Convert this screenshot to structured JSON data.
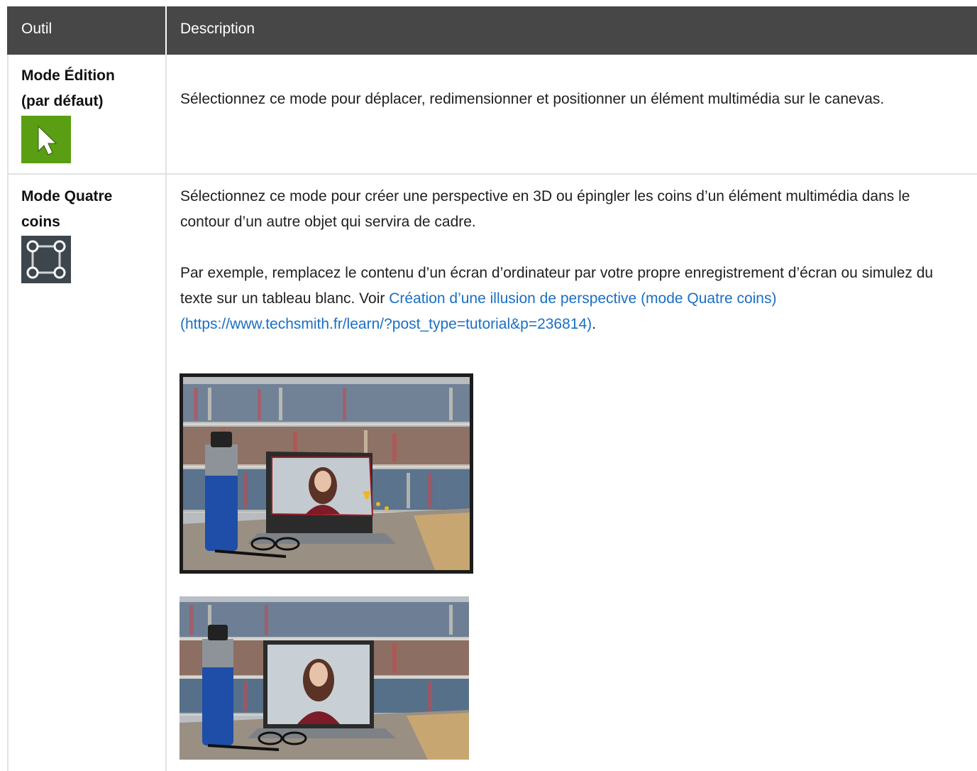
{
  "header": {
    "col_tool": "Outil",
    "col_description": "Description"
  },
  "rows": [
    {
      "tool_line1": "Mode Édition",
      "tool_line2": "(par défaut)",
      "icon": "arrow-cursor-icon",
      "icon_color": "#5a9e13",
      "description": "Sélectionnez ce mode pour déplacer, redimensionner et positionner un élément multimédia sur le canevas."
    },
    {
      "tool_line1": "Mode Quatre",
      "tool_line2": "coins",
      "icon": "four-corners-icon",
      "icon_color": "#3e464d",
      "description_p1": "Sélectionnez ce mode pour créer une perspective en 3D ou épingler les coins d’un élément multimédia dans le contour d’un autre objet qui servira de cadre.",
      "description_p2_text": "Par exemple, remplacez le contenu d’un écran d’ordinateur par votre propre enregistrement d’écran ou simulez du texte sur un tableau blanc. Voir ",
      "description_p2_link": "Création d’une illusion de perspective (mode Quatre coins) (https://www.techsmith.fr/learn/?post_type=tutorial&p=236814)",
      "description_p2_end": "."
    }
  ],
  "colors": {
    "header_bg": "#474747",
    "link": "#1a6fc4",
    "grid": "#e2e2e2"
  }
}
